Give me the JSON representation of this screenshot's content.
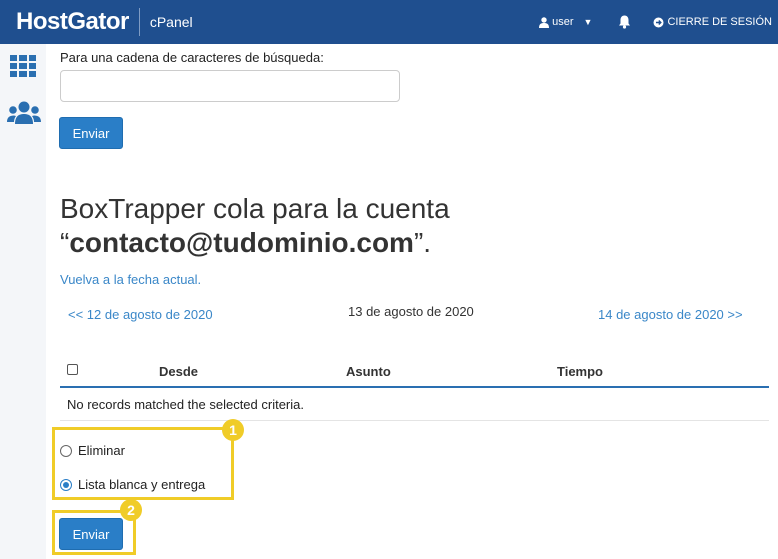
{
  "header": {
    "logo": "HostGator",
    "product": "cPanel",
    "user_label": "user",
    "logout_label": "CIERRE DE SESIÓN"
  },
  "sidebar": {
    "items": [
      {
        "icon": "grid-icon"
      },
      {
        "icon": "users-icon"
      }
    ]
  },
  "search": {
    "label": "Para una cadena de caracteres de búsqueda:",
    "value": "",
    "submit_label": "Enviar"
  },
  "queue": {
    "title_prefix": "BoxTrapper cola para la cuenta",
    "open_quote": "“",
    "account": "contacto@tudominio.com",
    "close_quote": "”."
  },
  "dates": {
    "back_to_today": "Vuelva a la fecha actual.",
    "previous": "<< 12 de agosto de 2020",
    "current": "13 de agosto de 2020",
    "next": "14 de agosto de 2020 >>"
  },
  "table": {
    "columns": [
      "Desde",
      "Asunto",
      "Tiempo"
    ],
    "empty_message": "No records matched the selected criteria."
  },
  "actions": {
    "options": [
      {
        "label": "Eliminar",
        "checked": false
      },
      {
        "label": "Lista blanca y entrega",
        "checked": true
      }
    ],
    "submit_label": "Enviar"
  },
  "callouts": {
    "badge_1": "1",
    "badge_2": "2",
    "color": "#f0cc28"
  },
  "colors": {
    "header_bg": "#1f4f8f",
    "button_bg": "#2a7ec7",
    "link": "#3a87c8"
  }
}
